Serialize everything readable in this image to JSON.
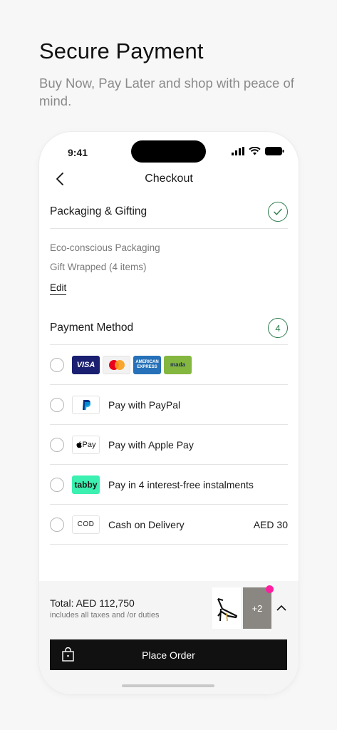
{
  "promo": {
    "title": "Secure Payment",
    "subtitle": "Buy Now, Pay Later and shop with peace of mind."
  },
  "status_bar": {
    "time": "9:41"
  },
  "header": {
    "title": "Checkout"
  },
  "packaging": {
    "label": "Packaging & Gifting",
    "eco": "Eco-conscious Packaging",
    "gift": "Gift Wrapped (4 items)",
    "edit": "Edit"
  },
  "payment": {
    "label": "Payment Method",
    "step": "4",
    "cards": [
      "VISA",
      "mastercard",
      "AMERICAN EXPRESS",
      "mada"
    ],
    "options": [
      {
        "label": "Pay with PayPal",
        "logo": "paypal-logo"
      },
      {
        "label": "Pay with Apple Pay",
        "logo_text": "Pay"
      },
      {
        "label": "Pay in 4 interest-free instalments",
        "logo_text": "tabby"
      },
      {
        "label": "Cash on Delivery",
        "logo_text": "COD",
        "amount": "AED 30"
      }
    ]
  },
  "footer": {
    "total": "Total: AED 112,750",
    "duties": "includes all taxes and /or duties",
    "more_items": "+2",
    "place_order": "Place Order"
  },
  "colors": {
    "accent_green": "#2e7d4f",
    "notification_pink": "#ff1ea0",
    "tabby_green": "#3bf0b0"
  }
}
